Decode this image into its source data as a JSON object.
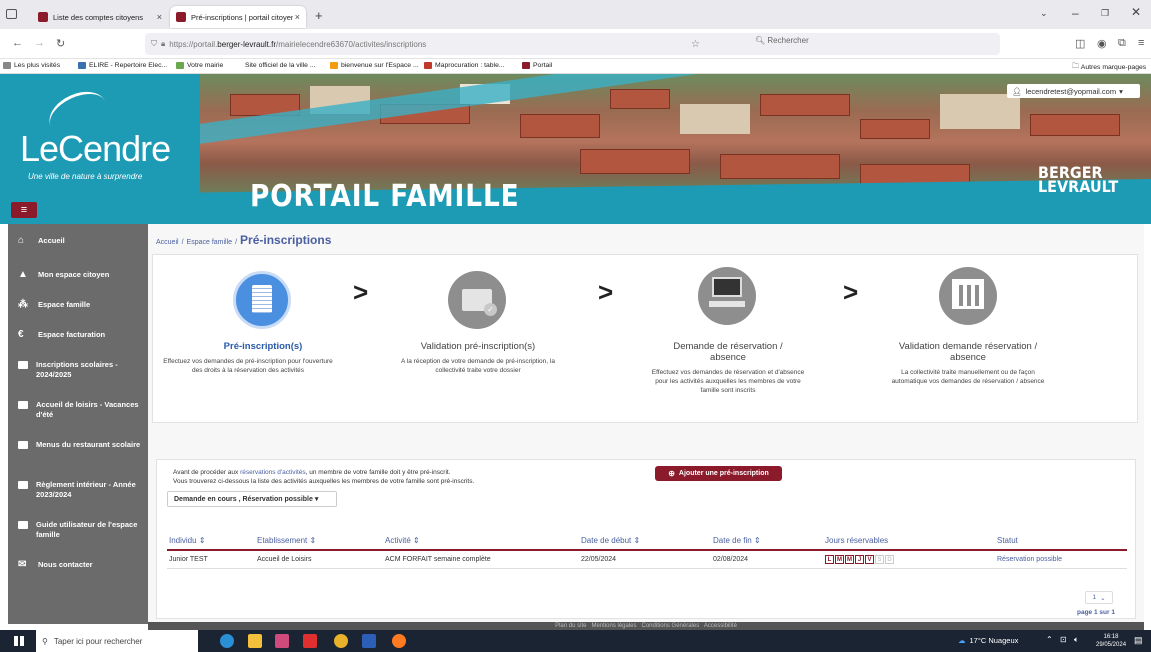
{
  "browser": {
    "tabs": [
      {
        "label": "Liste des comptes citoyens",
        "active": false
      },
      {
        "label": "Pré-inscriptions | portail citoyen",
        "active": true
      }
    ],
    "url_prefix": "https://portail.",
    "url_domain": "berger-levrault.fr",
    "url_path": "/mairielecendre63670/activites/inscriptions",
    "search_placeholder": "Rechercher",
    "bookmarks": [
      {
        "label": "Les plus visités",
        "color": "#888"
      },
      {
        "label": "ELIRE - Repertoire Elec...",
        "color": "#3a6fb0"
      },
      {
        "label": "Votre mairie",
        "color": "#6aa84f"
      },
      {
        "label": "Site officiel de la ville ...",
        "color": "#ffffff"
      },
      {
        "label": "bienvenue sur l'Espace ...",
        "color": "#f39c12"
      },
      {
        "label": "Maprocuration : table...",
        "color": "#c0392b"
      },
      {
        "label": "Portail",
        "color": "#8b1a2b"
      }
    ],
    "other_bookmarks": "Autres marque-pages"
  },
  "header": {
    "user_email": "lecendretest@yopmail.com",
    "logo_text": "LeCendre",
    "logo_tagline": "Une ville de nature à surprendre",
    "portal_title": "PORTAIL FAMILLE",
    "brand_line1": "BERGER",
    "brand_line2": "LEVRAULT"
  },
  "sidebar": {
    "items": [
      {
        "label": "Accueil",
        "icon": "home-icon"
      },
      {
        "label": "Mon espace citoyen",
        "icon": "user-icon"
      },
      {
        "label": "Espace famille",
        "icon": "family-icon"
      },
      {
        "label": "Espace facturation",
        "icon": "euro-icon"
      },
      {
        "label": "Inscriptions scolaires - 2024/2025",
        "icon": "document-icon"
      },
      {
        "label": "Accueil de loisirs - Vacances d'été",
        "icon": "document-icon"
      },
      {
        "label": "Menus du restaurant scolaire",
        "icon": "document-icon"
      },
      {
        "label": "Règlement intérieur - Année 2023/2024",
        "icon": "document-icon"
      },
      {
        "label": "Guide utilisateur de l'espace famille",
        "icon": "document-icon"
      },
      {
        "label": "Nous contacter",
        "icon": "mail-icon"
      }
    ]
  },
  "breadcrumb": {
    "home": "Accueil",
    "sep": "/",
    "section": "Espace famille",
    "current": "Pré-inscriptions"
  },
  "steps": [
    {
      "title": "Pré-inscription(s)",
      "desc": "Effectuez vos demandes de pré-inscription pour l'ouverture des droits à la réservation des activités"
    },
    {
      "title": "Validation pré-inscription(s)",
      "desc": "A la réception de votre demande de pré-inscription, la collectivité traite votre dossier"
    },
    {
      "title": "Demande de réservation / absence",
      "desc": "Effectuez vos demandes de réservation et d'absence pour les activités auxquelles les membres de votre famille sont inscrits"
    },
    {
      "title": "Validation demande réservation / absence",
      "desc": "La collectivité traite manuellement ou de façon automatique vos demandes de réservation / absence"
    }
  ],
  "info": {
    "line1_before": "Avant de procéder aux ",
    "line1_link": "réservations d'activités",
    "line1_after": ", un membre de votre famille doit y être pré-inscrit.",
    "line2": "Vous trouverez ci-dessous la liste des activités auxquelles les membres de votre famille sont pré-inscrits.",
    "filter": "Demande en cours , Réservation possible",
    "add_button": "Ajouter une pré-inscription"
  },
  "table": {
    "columns": [
      "Individu",
      "Etablissement",
      "Activité",
      "Date de début",
      "Date de fin",
      "Jours réservables",
      "Statut"
    ],
    "rows": [
      {
        "individu": "Junior TEST",
        "etablissement": "Accueil de Loisirs",
        "activite": "ACM FORFAIT semaine complète",
        "debut": "22/05/2024",
        "fin": "02/08/2024",
        "days": [
          "L",
          "M",
          "M",
          "J",
          "V",
          "S",
          "D"
        ],
        "days_enabled": [
          true,
          true,
          true,
          true,
          true,
          false,
          false
        ],
        "statut": "Réservation possible"
      }
    ],
    "page_select": "1",
    "page_info": "page 1 sur 1"
  },
  "footer": {
    "links": [
      "Plan du site",
      "Mentions légales",
      "Conditions Générales",
      "Accessibilité"
    ]
  },
  "taskbar": {
    "search_placeholder": "Taper ici pour rechercher",
    "weather": "17°C  Nuageux",
    "time": "16:18",
    "date": "29/05/2024"
  }
}
